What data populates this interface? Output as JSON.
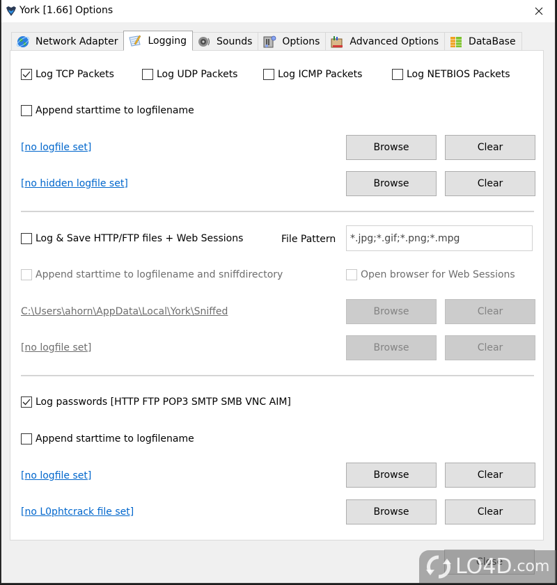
{
  "window": {
    "title": "York [1.66] Options",
    "close_glyph": "✕"
  },
  "tabs": [
    {
      "label": "Network Adapter",
      "icon": "globe-icon",
      "active": false
    },
    {
      "label": "Logging",
      "icon": "notepad-pencil-icon",
      "active": true
    },
    {
      "label": "Sounds",
      "icon": "speaker-icon",
      "active": false
    },
    {
      "label": "Options",
      "icon": "options-icon",
      "active": false
    },
    {
      "label": "Advanced Options",
      "icon": "toolbox-icon",
      "active": false
    },
    {
      "label": "DataBase",
      "icon": "database-icon",
      "active": false
    }
  ],
  "packets": {
    "tcp": {
      "label": "Log TCP Packets",
      "checked": true
    },
    "udp": {
      "label": "Log UDP Packets",
      "checked": false
    },
    "icmp": {
      "label": "Log ICMP Packets",
      "checked": false
    },
    "netbios": {
      "label": "Log NETBIOS Packets",
      "checked": false
    },
    "append": {
      "label": "Append starttime to logfilename",
      "checked": false
    },
    "logfile_link": "[no logfile set]",
    "hidden_logfile_link": "[no hidden logfile set]"
  },
  "http": {
    "log_save": {
      "label": "Log & Save HTTP/FTP files + Web Sessions",
      "checked": false
    },
    "file_pattern_label": "File Pattern",
    "file_pattern_value": "*.jpg;*.gif;*.png;*.mpg",
    "append": {
      "label": "Append starttime to logfilename and sniffdirectory",
      "checked": false,
      "disabled": true
    },
    "open_browser": {
      "label": "Open browser for Web Sessions",
      "checked": false,
      "disabled": true
    },
    "sniff_dir_link": "C:\\Users\\ahorn\\AppData\\Local\\York\\Sniffed",
    "logfile_link": "[no logfile set]"
  },
  "passwords": {
    "log_passwords": {
      "label": "Log passwords [HTTP FTP POP3 SMTP SMB VNC AIM]",
      "checked": true
    },
    "append": {
      "label": "Append starttime to logfilename",
      "checked": false
    },
    "logfile_link": "[no logfile set]",
    "l0phtcrack_link": "[no L0phtcrack file set]"
  },
  "buttons": {
    "browse": "Browse",
    "clear": "Clear",
    "close": "Close"
  },
  "watermark": {
    "text": "LO4D",
    "suffix": ".com"
  }
}
